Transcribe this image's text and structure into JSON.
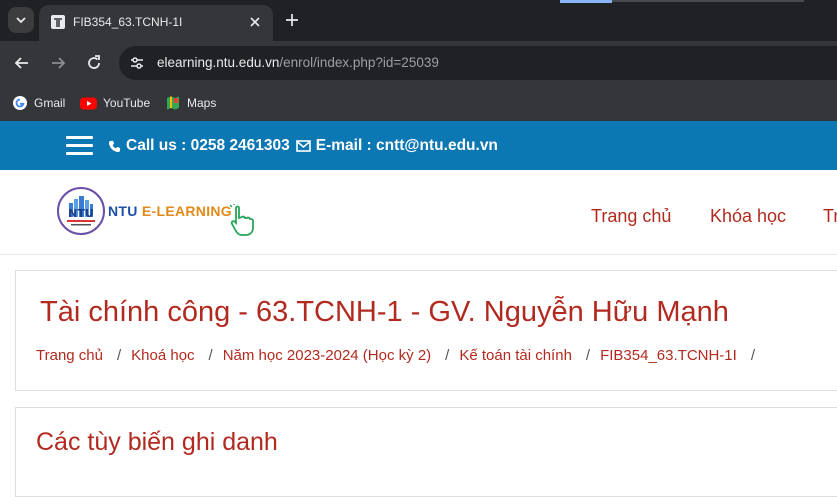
{
  "browser": {
    "tab": {
      "title": "FIB354_63.TCNH-1I"
    },
    "address": {
      "host": "elearning.ntu.edu.vn",
      "path": "/enrol/index.php?id=25039"
    },
    "bookmarks": [
      {
        "label": "Gmail",
        "icon": "gmail-icon"
      },
      {
        "label": "YouTube",
        "icon": "youtube-icon"
      },
      {
        "label": "Maps",
        "icon": "maps-icon"
      }
    ]
  },
  "site": {
    "topbar": {
      "call_label": "Call us : 0258 2461303",
      "email_label": "E-mail : cntt@ntu.edu.vn"
    },
    "logo": {
      "ntu": "NTU",
      "rest": " E-LEARNING"
    },
    "nav": [
      "Trang chủ",
      "Khóa học",
      "Tr"
    ]
  },
  "page": {
    "title": "Tài chính công - 63.TCNH-1 - GV. Nguyễn Hữu Mạnh",
    "breadcrumb": [
      "Trang chủ",
      "Khoá học",
      "Năm học 2023-2024 (Học kỳ 2)",
      "Kế toán tài chính",
      "FIB354_63.TCNH-1I"
    ],
    "section_title": "Các tùy biến ghi danh"
  },
  "colors": {
    "accent_red": "#b22a1f",
    "topbar_blue": "#0b77b3",
    "browser_dark": "#202124"
  }
}
